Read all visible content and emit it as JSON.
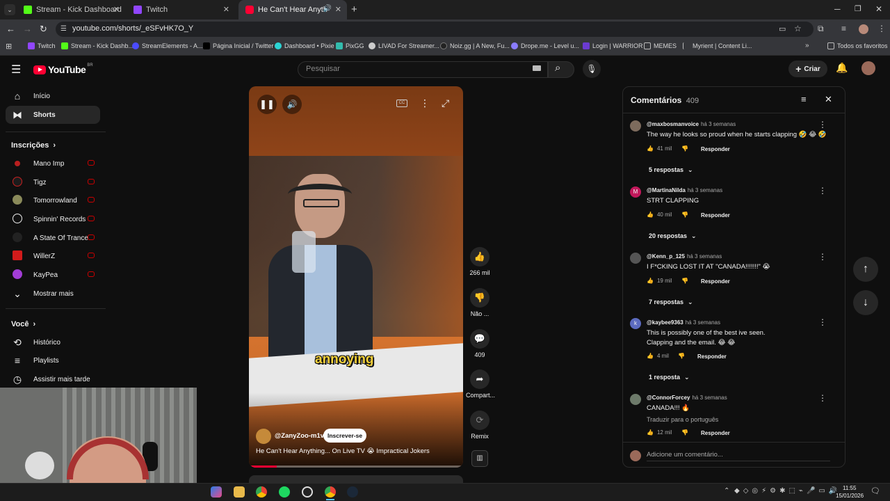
{
  "browser": {
    "tabs": [
      {
        "label": "Stream - Kick Dashboard",
        "color": "#53fc18"
      },
      {
        "label": "Twitch",
        "color": "#9146ff"
      },
      {
        "label": "He Can't Hear Anything... C",
        "color": "#ff0033"
      }
    ],
    "url": "youtube.com/shorts/_eSFvHK7O_Y",
    "bookmarks": [
      {
        "label": "Twitch",
        "color": "#9146ff"
      },
      {
        "label": "Stream - Kick Dashb...",
        "color": "#53fc18"
      },
      {
        "label": "StreamElements - A...",
        "color": "#4b4bff"
      },
      {
        "label": "Página Inicial / Twitter",
        "color": "#000000"
      },
      {
        "label": "Dashboard • Pixie",
        "color": "#2bd4d4"
      },
      {
        "label": "PixGG",
        "color": "#32bcad"
      },
      {
        "label": "LIVAD For Streamer...",
        "color": "#cccccc"
      },
      {
        "label": "Noiz.gg | A New, Fu...",
        "color": "#222222"
      },
      {
        "label": "Drope.me - Level u...",
        "color": "#8a7cff"
      },
      {
        "label": "Login | WARRIOR",
        "color": "#6b3bd1"
      },
      {
        "label": "MEMES",
        "color": "#888888"
      },
      {
        "label": "Myrient | Content Li...",
        "color": "#888888"
      }
    ],
    "all_favorites": "Todos os favoritos"
  },
  "youtube": {
    "logo": "YouTube",
    "region": "BR",
    "search_placeholder": "Pesquisar",
    "create_label": "Criar",
    "sidebar": {
      "home": "Início",
      "shorts": "Shorts",
      "subscriptions_title": "Inscrições",
      "subscriptions": [
        {
          "name": "Mano Imp",
          "color": "#b91f1f"
        },
        {
          "name": "Tigz",
          "color": "#cc2222"
        },
        {
          "name": "Tomorrowland",
          "color": "#8a8a5a"
        },
        {
          "name": "Spinnin' Records",
          "color": "#111111"
        },
        {
          "name": "A State Of Trance",
          "color": "#222222"
        },
        {
          "name": "WillerZ",
          "color": "#d11b1b"
        },
        {
          "name": "KayPea",
          "color": "#a23dd6"
        }
      ],
      "show_more": "Mostrar mais",
      "you_title": "Você",
      "history": "Histórico",
      "playlists": "Playlists",
      "watch_later": "Assistir mais tarde"
    },
    "short": {
      "caption": "annoying",
      "channel": "@ZanyZoo-m1v",
      "subscribe": "Inscrever-se",
      "title": "He Can't Hear Anything... On Live TV 😭 Impractical Jokers",
      "likes": "266 mil",
      "dislike": "Não ...",
      "comments_count": "409",
      "share": "Compart...",
      "remix": "Remix"
    },
    "comments_panel": {
      "title": "Comentários",
      "count": "409",
      "reply_label": "Responder",
      "add_placeholder": "Adicione um comentário...",
      "items": [
        {
          "user": "@maxbosmanvoice",
          "time": "há 3 semanas",
          "text": "The way he looks so proud when he starts clapping 🤣 😂 🤣",
          "likes": "41 mil",
          "replies": "5 respostas",
          "avatar": "#7d6b5d"
        },
        {
          "user": "@MartinaNilda",
          "time": "há 3 semanas",
          "text": "STRT CLAPPING",
          "likes": "40 mil",
          "replies": "20 respostas",
          "avatar": "#c2185b",
          "initial": "M"
        },
        {
          "user": "@Kenn_p_125",
          "time": "há 3 semanas",
          "text": "I F*CKING LOST IT AT \"CANADA!!!!!!!\" 😭",
          "likes": "19 mil",
          "replies": "7 respostas",
          "avatar": "#555555"
        },
        {
          "user": "@kaybee9363",
          "time": "há 3 semanas",
          "text": "This is possibly one of the best ive seen.",
          "text2": "Clapping and the email. 😂 😂",
          "likes": "4 mil",
          "replies": "1 resposta",
          "avatar": "#5c6bc0",
          "initial": "k"
        },
        {
          "user": "@ConnorForcey",
          "time": "há 3 semanas",
          "text": "CANADA!!! 🔥",
          "translate": "Traduzir para o português",
          "likes": "12 mil",
          "avatar": "#6d7a6a"
        }
      ]
    }
  },
  "taskbar": {
    "time": "11:55",
    "date": "15/01/2026"
  }
}
